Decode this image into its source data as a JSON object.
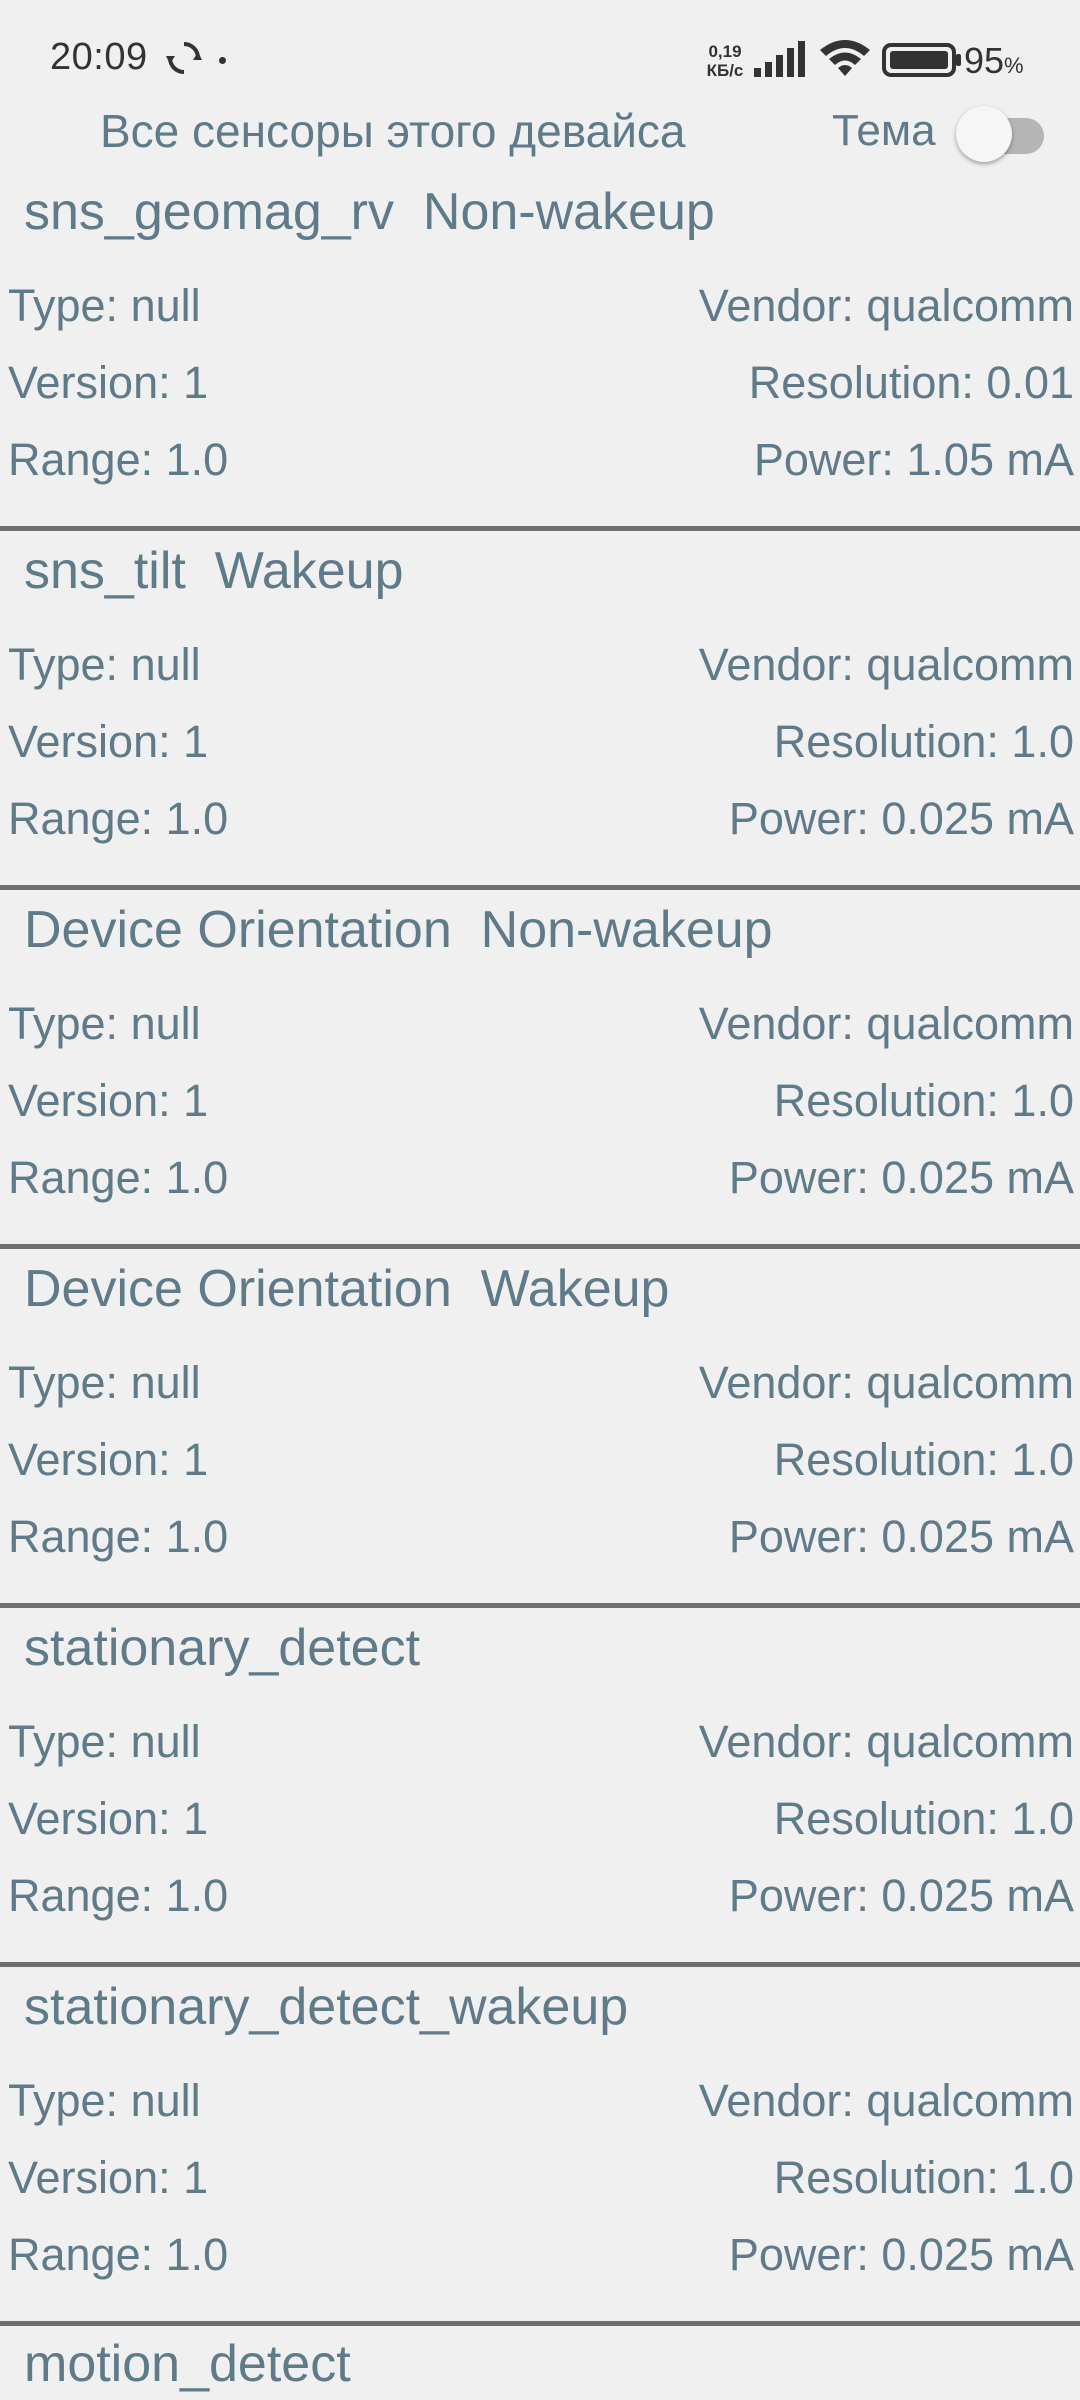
{
  "status_bar": {
    "time": "20:09",
    "net_speed_value": "0,19",
    "net_speed_unit": "КБ/с",
    "battery_value": "95",
    "battery_unit": "%",
    "icons": [
      "sync-icon",
      "dot-icon",
      "signal-icon",
      "wifi-icon",
      "battery-icon"
    ]
  },
  "header": {
    "title": "Все сенсоры этого девайса",
    "theme_label": "Тема",
    "theme_switch_on": false
  },
  "sensors": [
    {
      "name": "sns_geomag_rv  Non-wakeup",
      "type": "Type: null",
      "vendor": "Vendor: qualcomm",
      "version": "Version: 1",
      "resolution": "Resolution: 0.01",
      "range": "Range: 1.0",
      "power": "Power: 1.05 mA"
    },
    {
      "name": "sns_tilt  Wakeup",
      "type": "Type: null",
      "vendor": "Vendor: qualcomm",
      "version": "Version: 1",
      "resolution": "Resolution: 1.0",
      "range": "Range: 1.0",
      "power": "Power: 0.025 mA"
    },
    {
      "name": "Device Orientation  Non-wakeup",
      "type": "Type: null",
      "vendor": "Vendor: qualcomm",
      "version": "Version: 1",
      "resolution": "Resolution: 1.0",
      "range": "Range: 1.0",
      "power": "Power: 0.025 mA"
    },
    {
      "name": "Device Orientation  Wakeup",
      "type": "Type: null",
      "vendor": "Vendor: qualcomm",
      "version": "Version: 1",
      "resolution": "Resolution: 1.0",
      "range": "Range: 1.0",
      "power": "Power: 0.025 mA"
    },
    {
      "name": "stationary_detect",
      "type": "Type: null",
      "vendor": "Vendor: qualcomm",
      "version": "Version: 1",
      "resolution": "Resolution: 1.0",
      "range": "Range: 1.0",
      "power": "Power: 0.025 mA"
    },
    {
      "name": "stationary_detect_wakeup",
      "type": "Type: null",
      "vendor": "Vendor: qualcomm",
      "version": "Version: 1",
      "resolution": "Resolution: 1.0",
      "range": "Range: 1.0",
      "power": "Power: 0.025 mA"
    }
  ],
  "partial_sensor": {
    "name": "motion_detect"
  },
  "colors": {
    "background": "#f0f0f0",
    "text": "#5f7a88",
    "divider": "#707070",
    "status_text": "#333333"
  }
}
